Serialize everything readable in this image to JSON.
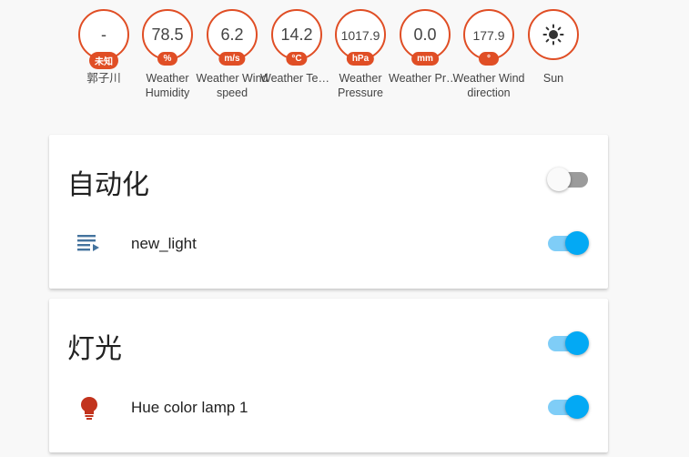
{
  "badges": [
    {
      "value": "-",
      "unit": "未知",
      "label": "郭子川"
    },
    {
      "value": "78.5",
      "unit": "%",
      "label": "Weather Humidity"
    },
    {
      "value": "6.2",
      "unit": "m/s",
      "label": "Weather Wind speed"
    },
    {
      "value": "14.2",
      "unit": "°C",
      "label": "Weather Temperat…"
    },
    {
      "value": "1017.9",
      "unit": "hPa",
      "label": "Weather Pressure"
    },
    {
      "value": "0.0",
      "unit": "mm",
      "label": "Weather Precipitat…"
    },
    {
      "value": "177.9",
      "unit": "°",
      "label": "Weather Wind direction"
    },
    {
      "icon": "sun-icon",
      "label": "Sun"
    }
  ],
  "cards": [
    {
      "title": "自动化",
      "header_toggle": "off",
      "rows": [
        {
          "icon": "automation-list-icon",
          "name": "new_light",
          "toggle": "on"
        }
      ]
    },
    {
      "title": "灯光",
      "header_toggle": "on",
      "rows": [
        {
          "icon": "lightbulb-icon",
          "name": "Hue color lamp 1",
          "toggle": "on"
        }
      ]
    }
  ],
  "colors": {
    "accent": "#e04e25",
    "toggle_on": "#03a9f4",
    "toggle_on_track": "#7fcdf7",
    "lamp": "#c2331d",
    "automation_icon": "#44739e"
  }
}
